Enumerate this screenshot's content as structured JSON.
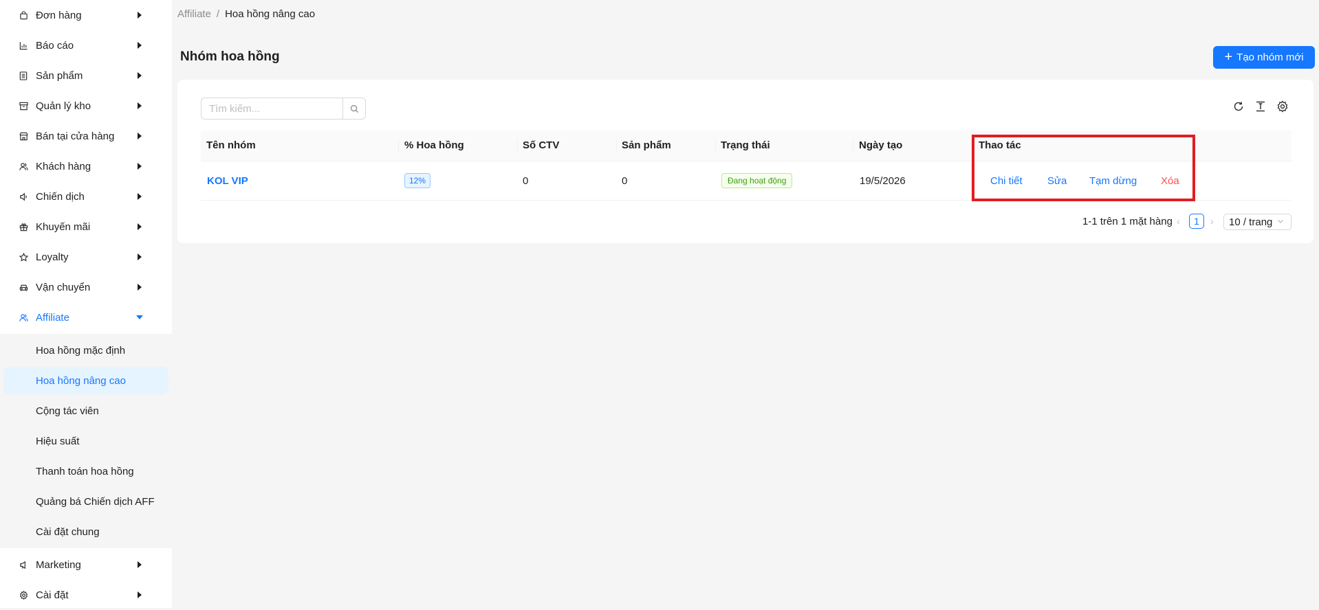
{
  "sidebar": {
    "items": [
      {
        "label": "Đơn hàng",
        "icon": "shopping-bag-icon"
      },
      {
        "label": "Báo cáo",
        "icon": "bar-chart-icon"
      },
      {
        "label": "Sản phẩm",
        "icon": "document-icon"
      },
      {
        "label": "Quản lý kho",
        "icon": "archive-icon"
      },
      {
        "label": "Bán tại cửa hàng",
        "icon": "shop-icon"
      },
      {
        "label": "Khách hàng",
        "icon": "customers-icon"
      },
      {
        "label": "Chiến dịch",
        "icon": "sound-icon"
      },
      {
        "label": "Khuyến mãi",
        "icon": "gift-icon"
      },
      {
        "label": "Loyalty",
        "icon": "star-icon"
      },
      {
        "label": "Vận chuyển",
        "icon": "car-icon"
      },
      {
        "label": "Affiliate",
        "icon": "team-icon",
        "active": true
      }
    ],
    "submenu": [
      {
        "label": "Hoa hồng mặc định"
      },
      {
        "label": "Hoa hồng nâng cao",
        "selected": true
      },
      {
        "label": "Cộng tác viên"
      },
      {
        "label": "Hiệu suất"
      },
      {
        "label": "Thanh toán hoa hồng"
      },
      {
        "label": "Quảng bá Chiến dịch AFF"
      },
      {
        "label": "Cài đặt chung"
      }
    ],
    "bottom_items": [
      {
        "label": "Marketing",
        "icon": "notification-icon"
      },
      {
        "label": "Cài đặt",
        "icon": "gear-icon"
      }
    ]
  },
  "breadcrumb": {
    "parent": "Affiliate",
    "separator": "/",
    "current": "Hoa hồng nâng cao"
  },
  "page": {
    "title": "Nhóm hoa hồng",
    "create_button": "Tạo nhóm mới"
  },
  "search": {
    "placeholder": "Tìm kiếm..."
  },
  "table": {
    "columns": [
      "Tên nhóm",
      "% Hoa hồng",
      "Số CTV",
      "Sản phẩm",
      "Trạng thái",
      "Ngày tạo",
      "Thao tác"
    ],
    "rows": [
      {
        "name": "KOL VIP",
        "commission": "12%",
        "ctv": "0",
        "products": "0",
        "status": "Đang hoạt động",
        "created": "19/5/2026",
        "actions": [
          "Chi tiết",
          "Sửa",
          "Tạm dừng",
          "Xóa"
        ]
      }
    ]
  },
  "pagination": {
    "total_text": "1-1 trên 1 mặt hàng",
    "current_page": "1",
    "page_size": "10 / trang"
  },
  "colors": {
    "primary": "#1677ff",
    "danger": "#ff4d4f",
    "highlight": "#e01e22",
    "success": "#389e0d"
  }
}
